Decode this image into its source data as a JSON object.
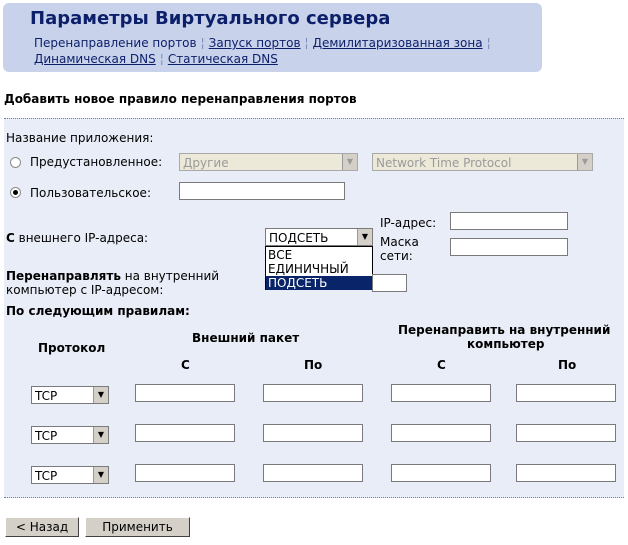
{
  "header": {
    "title": "Параметры Виртуального сервера",
    "nav": [
      {
        "label": "Перенаправление портов",
        "link": false
      },
      {
        "label": "Запуск портов",
        "link": true
      },
      {
        "label": "Демилитаризованная зона",
        "link": true
      },
      {
        "label": "Динамическая DNS",
        "link": true
      },
      {
        "label": "Статическая DNS",
        "link": true
      }
    ]
  },
  "section_title": "Добавить новое правило перенаправления портов",
  "form": {
    "app_name_label": "Название приложения:",
    "preset_label": "Предустановленное:",
    "preset_category": "Другие",
    "preset_service": "Network Time Protocol",
    "custom_label": "Пользовательское:",
    "custom_value": "",
    "custom_selected": true,
    "external_ip_label_bold": "С",
    "external_ip_label_rest": " внешнего IP-адреса:",
    "external_ip_mode": "ПОДСЕТЬ",
    "external_ip_options": [
      "ВСЕ",
      "ЕДИНИЧНЫЙ",
      "ПОДСЕТЬ"
    ],
    "ip_label": "IP-адрес:",
    "mask_label_line1": "Маска",
    "mask_label_line2": "сети:",
    "forward_label_bold": "Перенаправлять",
    "forward_label_rest": " на внутренний",
    "forward_label_line2": "компьютер с IP-адресом:",
    "rules_label": "По следующим правилам:"
  },
  "rules_table": {
    "protocol_header": "Протокол",
    "external_header": "Внешний пакет",
    "internal_header_line1": "Перенаправить на внутренний",
    "internal_header_line2": "компьютер",
    "from_label": "С",
    "to_label": "По",
    "rows": [
      {
        "protocol": "TCP"
      },
      {
        "protocol": "TCP"
      },
      {
        "protocol": "TCP"
      }
    ]
  },
  "buttons": {
    "back": "< Назад",
    "apply": "Применить"
  }
}
